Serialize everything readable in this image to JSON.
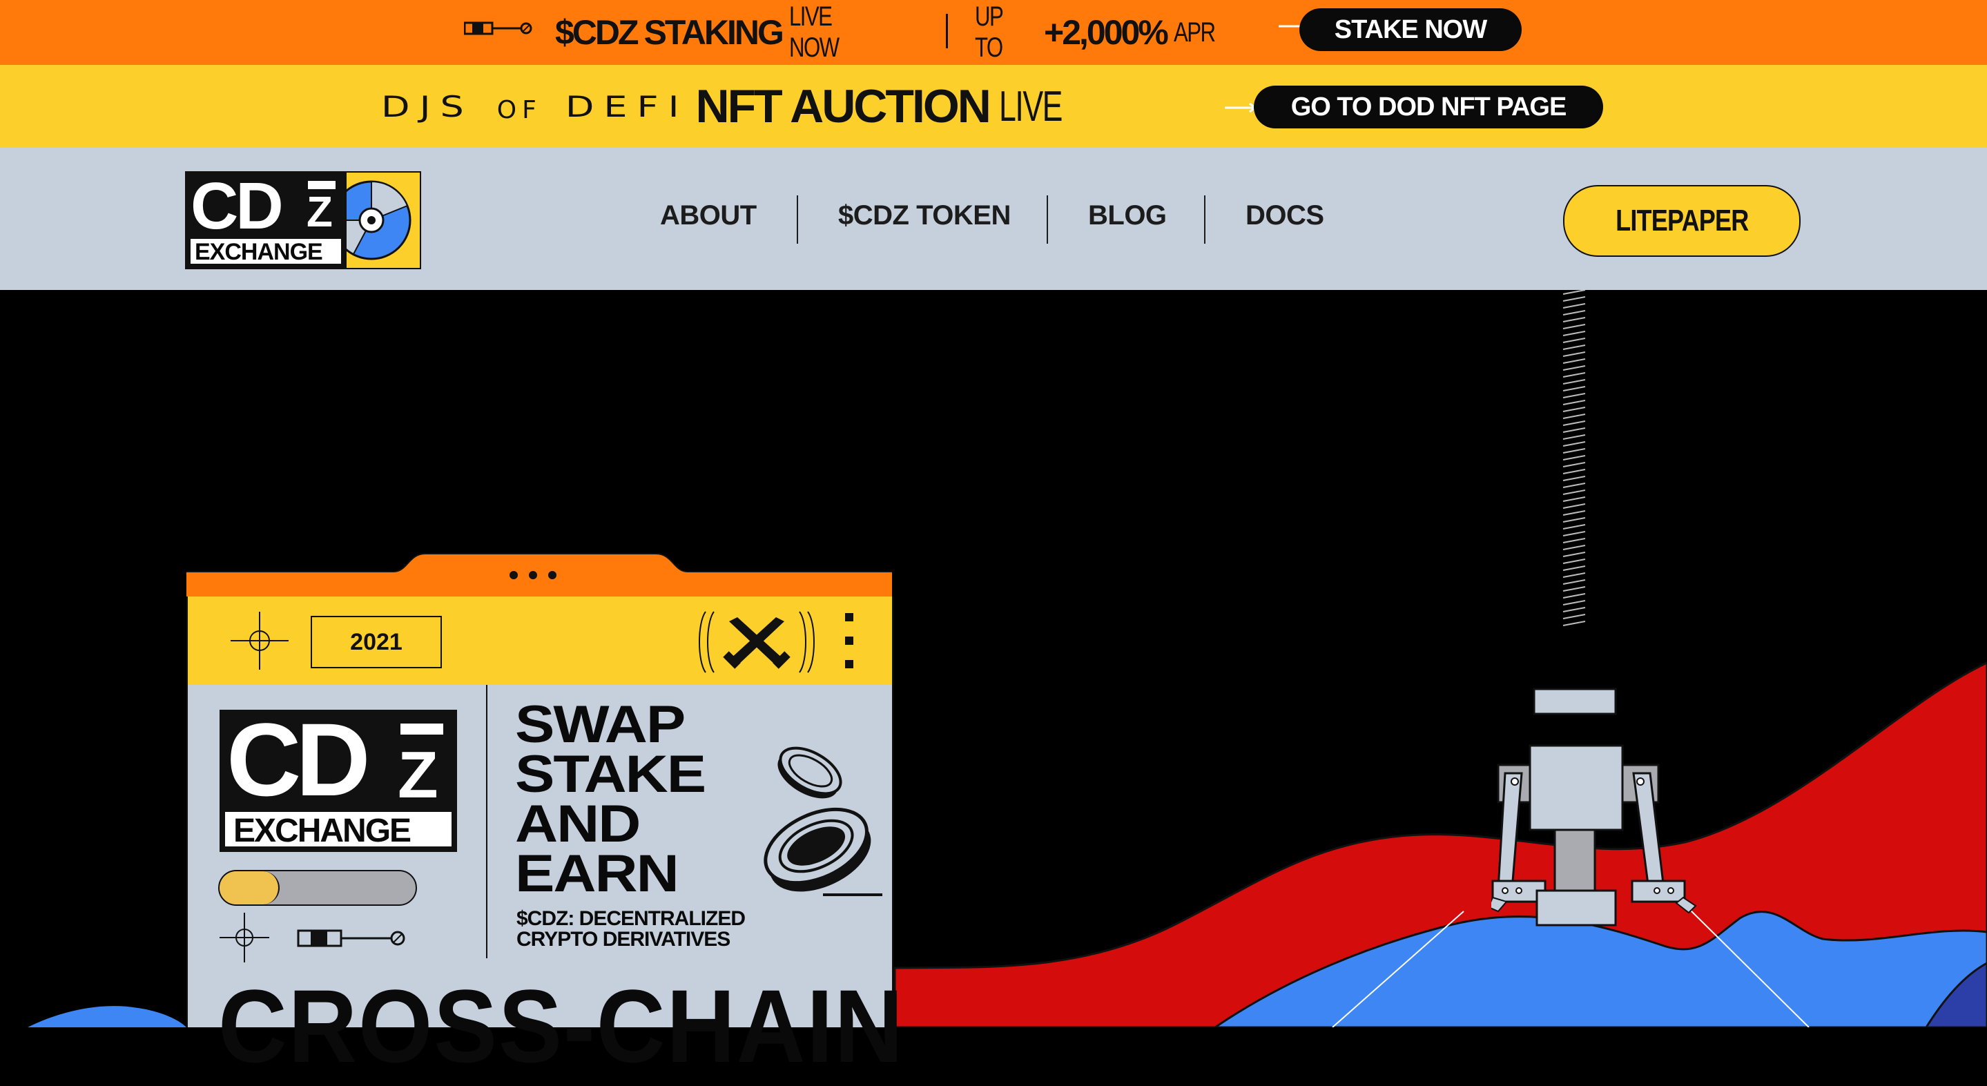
{
  "announcement_bar": {
    "token": "$CDZ",
    "staking": "STAKING",
    "live_now": "LIVE NOW",
    "up_to": "UP TO",
    "apr_value": "+2,000%",
    "apr": "APR",
    "cta": "STAKE NOW"
  },
  "auction_bar": {
    "collection_djs": "DJS",
    "collection_of": "OF",
    "collection_defi": "DEFI",
    "nft_auction": "NFT AUCTION",
    "live": "LIVE",
    "cta": "GO TO DOD NFT PAGE"
  },
  "header": {
    "logo_main": "CD",
    "logo_z": "Z",
    "logo_sub": "EXCHANGE",
    "nav": [
      {
        "label": "ABOUT"
      },
      {
        "label": "$CDZ TOKEN"
      },
      {
        "label": "BLOG"
      },
      {
        "label": "DOCS"
      }
    ],
    "litepaper": "LITEPAPER"
  },
  "hero_card": {
    "year": "2021",
    "logo_main": "CD",
    "logo_z": "Z",
    "logo_sub": "EXCHANGE",
    "headline": [
      "SWAP",
      "STAKE",
      "AND",
      "EARN"
    ],
    "subtitle_line1": "$CDZ: DECENTRALIZED",
    "subtitle_line2": "CRYPTO DERIVATIVES",
    "big_text": "CROSS-CHAIN",
    "toggle_progress": 0.3
  },
  "colors": {
    "orange": "#ff7a0a",
    "yellow": "#fdcf2b",
    "nav_bg": "#c5d0dc",
    "red": "#d40c0c",
    "blue": "#3f86f5",
    "black": "#000000"
  },
  "icons": [
    "slider-icon",
    "arrow-right-icon",
    "disc-icon",
    "crosshair-icon",
    "crossed-tools-icon",
    "coin-icon",
    "claw-icon",
    "dots-icon"
  ]
}
